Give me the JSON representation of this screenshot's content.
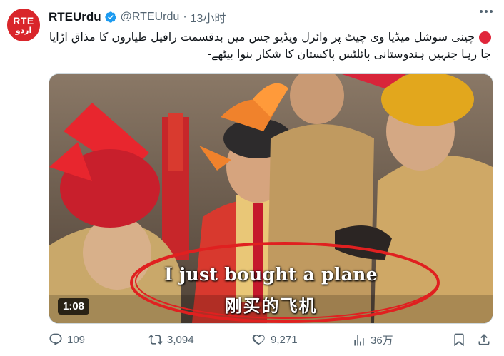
{
  "author": {
    "display_name": "RTEUrdu",
    "handle": "@RTEUrdu",
    "separator": "·",
    "time": "13小时",
    "avatar_top": "RTE",
    "avatar_bottom": "اردو",
    "avatar_color": "#d9262b",
    "verified_color": "#1d9bf0"
  },
  "tweet": {
    "text": "چینی سوشل میڈیا وی چیٹ پر وائرل ویڈیو جس میں بدقسمت رافیل طیاروں کا مذاق اڑایا جا رہا جنہیں ہندوستانی پائلٹس پاکستان کا شکار بنوا بیٹھے-"
  },
  "media": {
    "duration": "1:08",
    "subtitle_en": "I just bought a plane",
    "subtitle_zh": "刚买的飞机",
    "annotation_color": "#e02020"
  },
  "actions": {
    "replies": "109",
    "retweets": "3,094",
    "likes": "9,271",
    "views": "36万"
  }
}
